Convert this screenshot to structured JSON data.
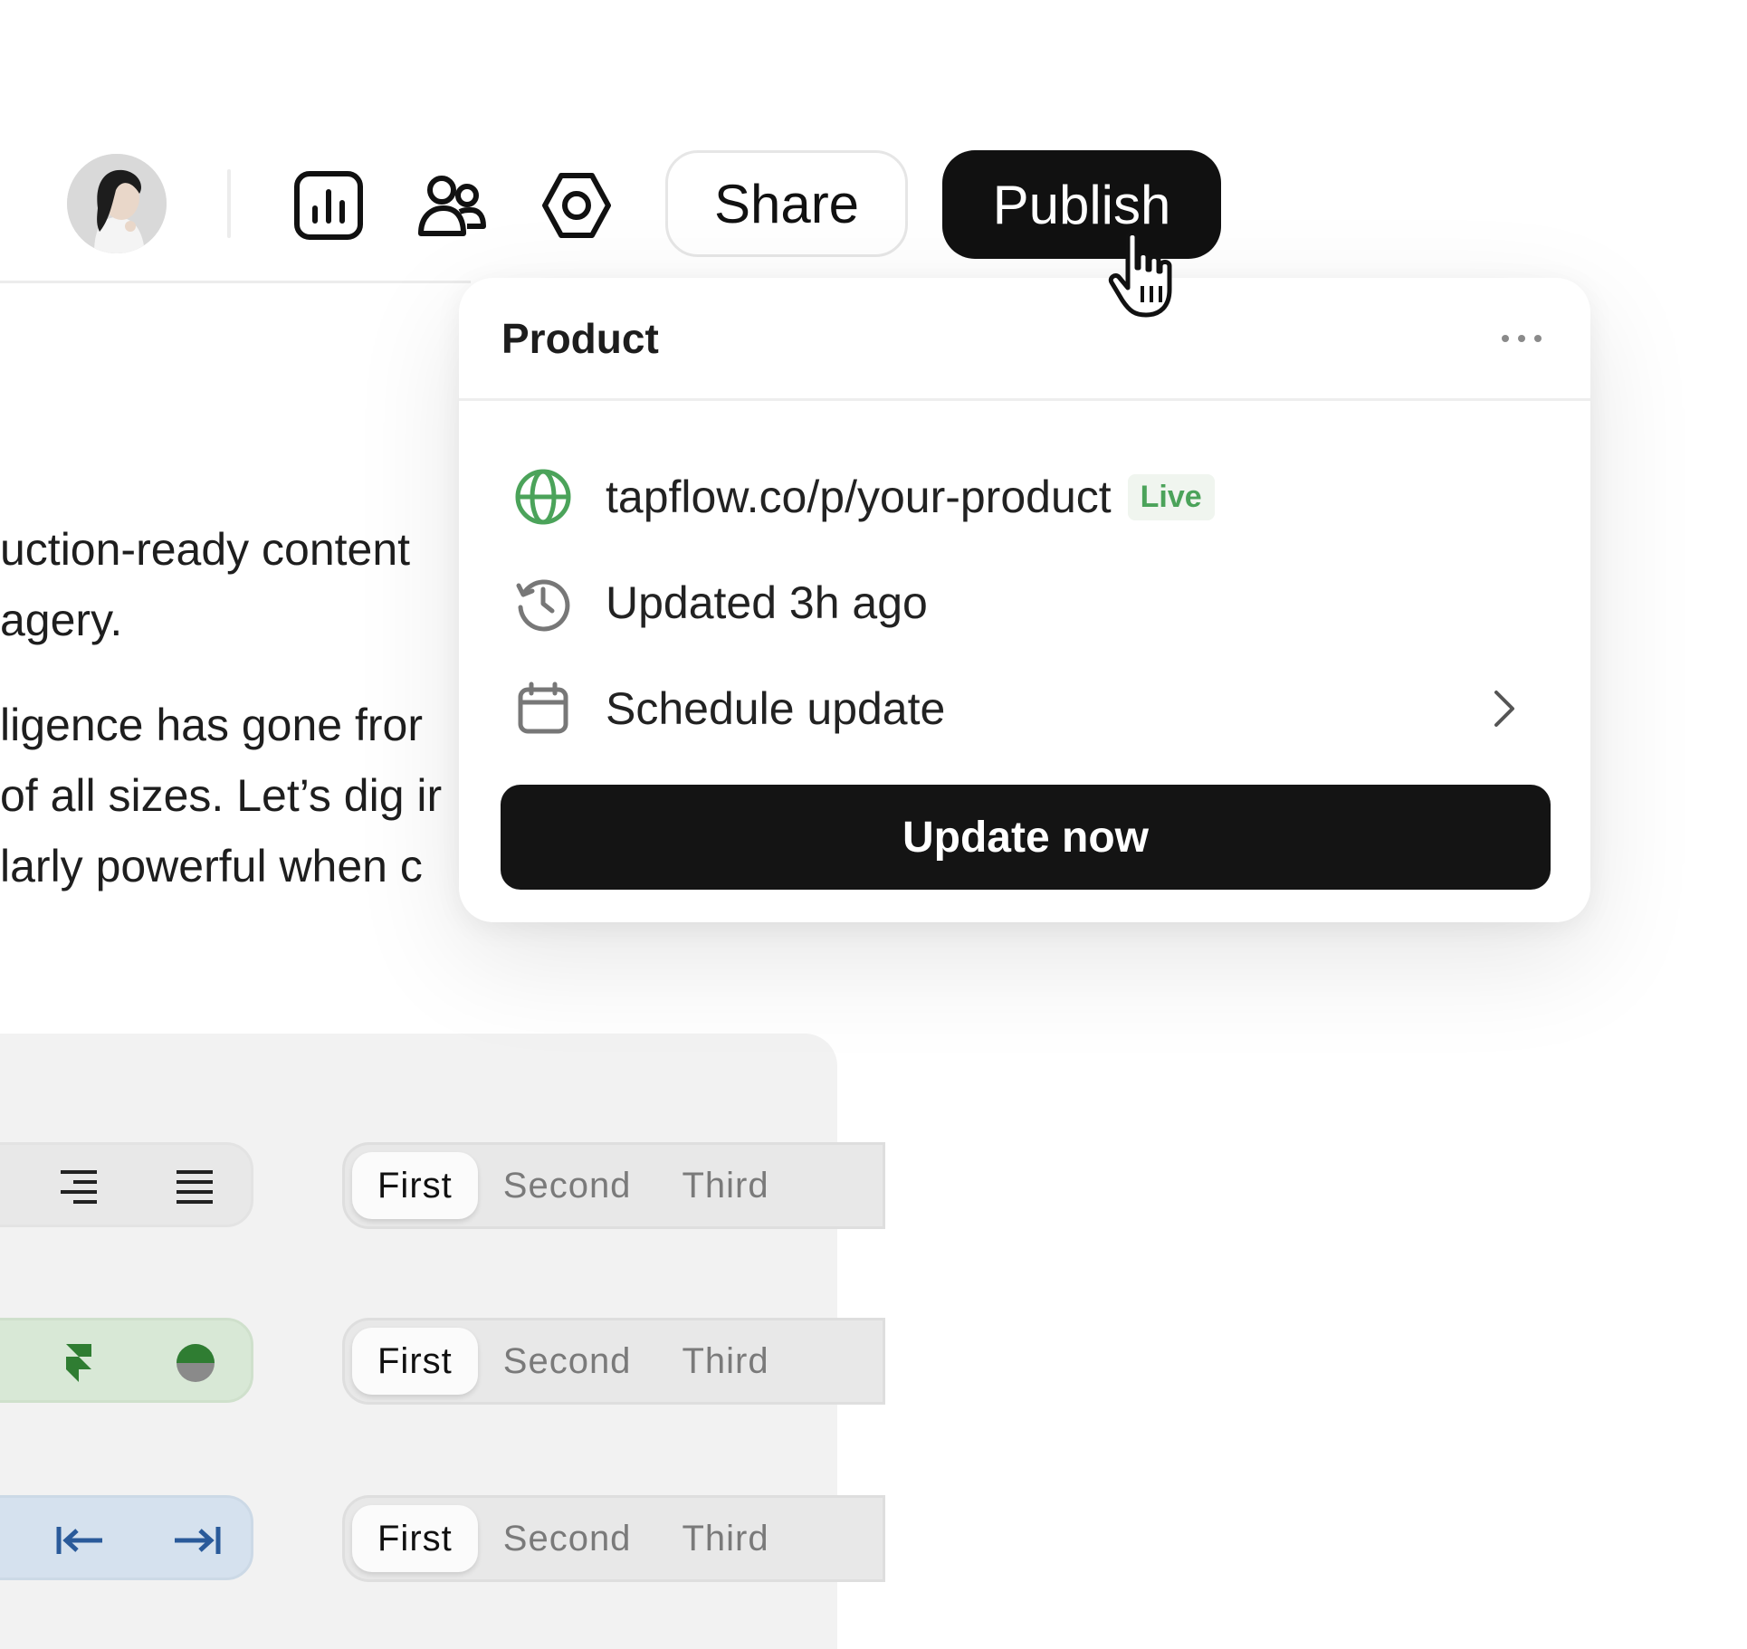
{
  "toolbar": {
    "share_label": "Share",
    "publish_label": "Publish",
    "icons": [
      "analytics-icon",
      "users-icon",
      "settings-icon"
    ]
  },
  "article": {
    "lines": [
      "uction-ready content",
      "agery.",
      "ligence has gone fror",
      "of all sizes. Let’s dig ir",
      "larly powerful when c"
    ]
  },
  "popover": {
    "title": "Product",
    "url": "tapflow.co/p/your-product",
    "live_badge": "Live",
    "updated": "Updated 3h ago",
    "schedule": "Schedule update",
    "update_button": "Update now",
    "accent_color": "#4ba35a"
  },
  "controls": {
    "rows": [
      {
        "theme": "neutral",
        "segments": [
          "First",
          "Second",
          "Third"
        ],
        "active": 0
      },
      {
        "theme": "green",
        "segments": [
          "First",
          "Second",
          "Third"
        ],
        "active": 0
      },
      {
        "theme": "blue",
        "segments": [
          "First",
          "Second",
          "Third"
        ],
        "active": 0
      }
    ]
  }
}
